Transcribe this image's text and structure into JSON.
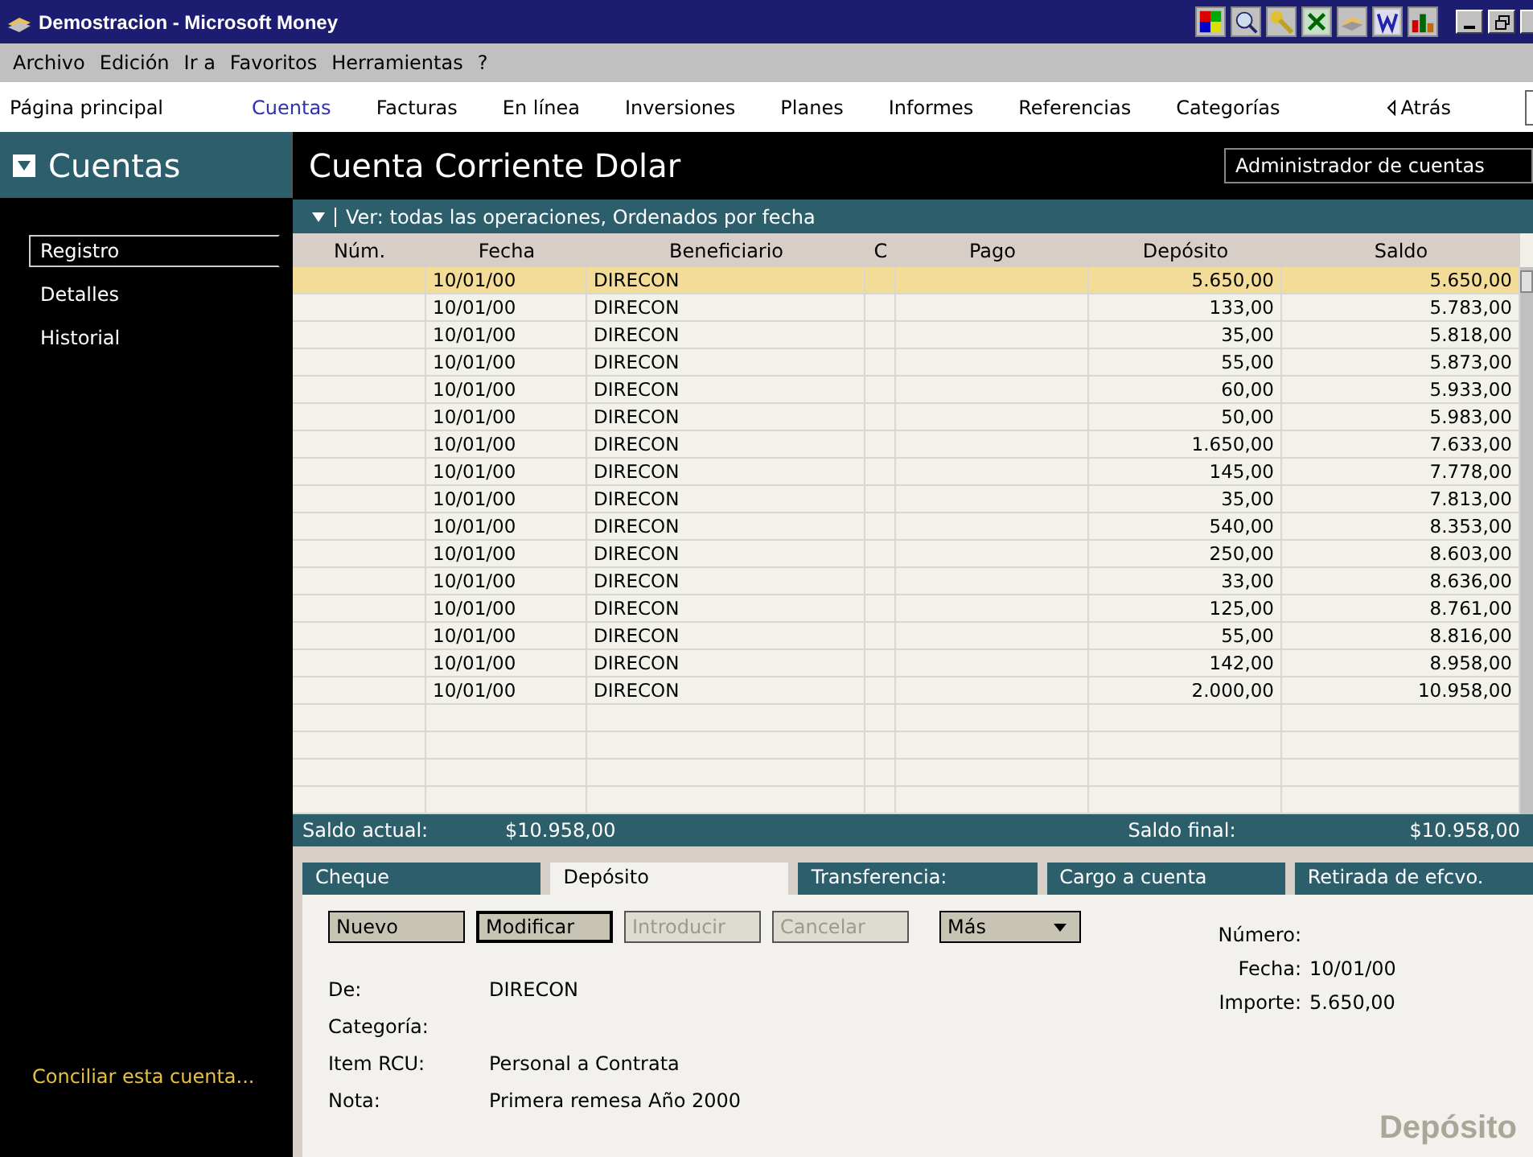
{
  "window": {
    "title": "Demostracion - Microsoft Money"
  },
  "menu": [
    "Archivo",
    "Edición",
    "Ir a",
    "Favoritos",
    "Herramientas",
    "?"
  ],
  "nav": [
    {
      "label": "Página principal",
      "selected": false
    },
    {
      "label": "Cuentas",
      "selected": true
    },
    {
      "label": "Facturas",
      "selected": false
    },
    {
      "label": "En línea",
      "selected": false
    },
    {
      "label": "Inversiones",
      "selected": false
    },
    {
      "label": "Planes",
      "selected": false
    },
    {
      "label": "Informes",
      "selected": false
    },
    {
      "label": "Referencias",
      "selected": false
    },
    {
      "label": "Categorías",
      "selected": false
    }
  ],
  "back": "Atrás",
  "sidebar": {
    "title": "Cuentas",
    "items": [
      {
        "label": "Registro",
        "selected": true
      },
      {
        "label": "Detalles",
        "selected": false
      },
      {
        "label": "Historial",
        "selected": false
      }
    ],
    "footer_link": "Conciliar esta cuenta..."
  },
  "account": {
    "title": "Cuenta Corriente Dolar",
    "manager_button": "Administrador de cuentas"
  },
  "filter": "Ver: todas las operaciones, Ordenados por fecha",
  "table": {
    "columns": [
      "Núm.",
      "Fecha",
      "Beneficiario",
      "C",
      "Pago",
      "Depósito",
      "Saldo"
    ],
    "rows": [
      {
        "date": "10/01/00",
        "payee": "DIRECON",
        "deposit": "5.650,00",
        "balance": "5.650,00",
        "selected": true
      },
      {
        "date": "10/01/00",
        "payee": "DIRECON",
        "deposit": "133,00",
        "balance": "5.783,00",
        "selected": false
      },
      {
        "date": "10/01/00",
        "payee": "DIRECON",
        "deposit": "35,00",
        "balance": "5.818,00",
        "selected": false
      },
      {
        "date": "10/01/00",
        "payee": "DIRECON",
        "deposit": "55,00",
        "balance": "5.873,00",
        "selected": false
      },
      {
        "date": "10/01/00",
        "payee": "DIRECON",
        "deposit": "60,00",
        "balance": "5.933,00",
        "selected": false
      },
      {
        "date": "10/01/00",
        "payee": "DIRECON",
        "deposit": "50,00",
        "balance": "5.983,00",
        "selected": false
      },
      {
        "date": "10/01/00",
        "payee": "DIRECON",
        "deposit": "1.650,00",
        "balance": "7.633,00",
        "selected": false
      },
      {
        "date": "10/01/00",
        "payee": "DIRECON",
        "deposit": "145,00",
        "balance": "7.778,00",
        "selected": false
      },
      {
        "date": "10/01/00",
        "payee": "DIRECON",
        "deposit": "35,00",
        "balance": "7.813,00",
        "selected": false
      },
      {
        "date": "10/01/00",
        "payee": "DIRECON",
        "deposit": "540,00",
        "balance": "8.353,00",
        "selected": false
      },
      {
        "date": "10/01/00",
        "payee": "DIRECON",
        "deposit": "250,00",
        "balance": "8.603,00",
        "selected": false
      },
      {
        "date": "10/01/00",
        "payee": "DIRECON",
        "deposit": "33,00",
        "balance": "8.636,00",
        "selected": false
      },
      {
        "date": "10/01/00",
        "payee": "DIRECON",
        "deposit": "125,00",
        "balance": "8.761,00",
        "selected": false
      },
      {
        "date": "10/01/00",
        "payee": "DIRECON",
        "deposit": "55,00",
        "balance": "8.816,00",
        "selected": false
      },
      {
        "date": "10/01/00",
        "payee": "DIRECON",
        "deposit": "142,00",
        "balance": "8.958,00",
        "selected": false
      },
      {
        "date": "10/01/00",
        "payee": "DIRECON",
        "deposit": "2.000,00",
        "balance": "10.958,00",
        "selected": false
      }
    ]
  },
  "balances": {
    "current_label": "Saldo actual:",
    "current": "$10.958,00",
    "final_label": "Saldo final:",
    "final": "$10.958,00"
  },
  "form_tabs": [
    {
      "label": "Cheque",
      "selected": false
    },
    {
      "label": "Depósito",
      "selected": true
    },
    {
      "label": "Transferencia:",
      "selected": false
    },
    {
      "label": "Cargo a cuenta",
      "selected": false
    },
    {
      "label": "Retirada de efcvo.",
      "selected": false
    }
  ],
  "buttons": [
    {
      "label": "Nuevo",
      "disabled": false,
      "kind": "button"
    },
    {
      "label": "Modificar",
      "disabled": false,
      "kind": "button"
    },
    {
      "label": "Introducir",
      "disabled": true,
      "kind": "button"
    },
    {
      "label": "Cancelar",
      "disabled": true,
      "kind": "button"
    },
    {
      "label": "Más",
      "disabled": false,
      "kind": "dropdown"
    }
  ],
  "fields": [
    {
      "label": "De:",
      "value": "DIRECON"
    },
    {
      "label": "Categoría:"
    },
    {
      "label": "Item RCU:",
      "value": "Personal a Contrata"
    },
    {
      "label": "Nota:",
      "value": "Primera remesa Año 2000"
    }
  ],
  "right_fields": [
    {
      "label": "Número:"
    },
    {
      "label": "Fecha:",
      "value": "10/01/00"
    },
    {
      "label": "Importe:",
      "value": "5.650,00"
    }
  ],
  "form_watermark": "Depósito"
}
